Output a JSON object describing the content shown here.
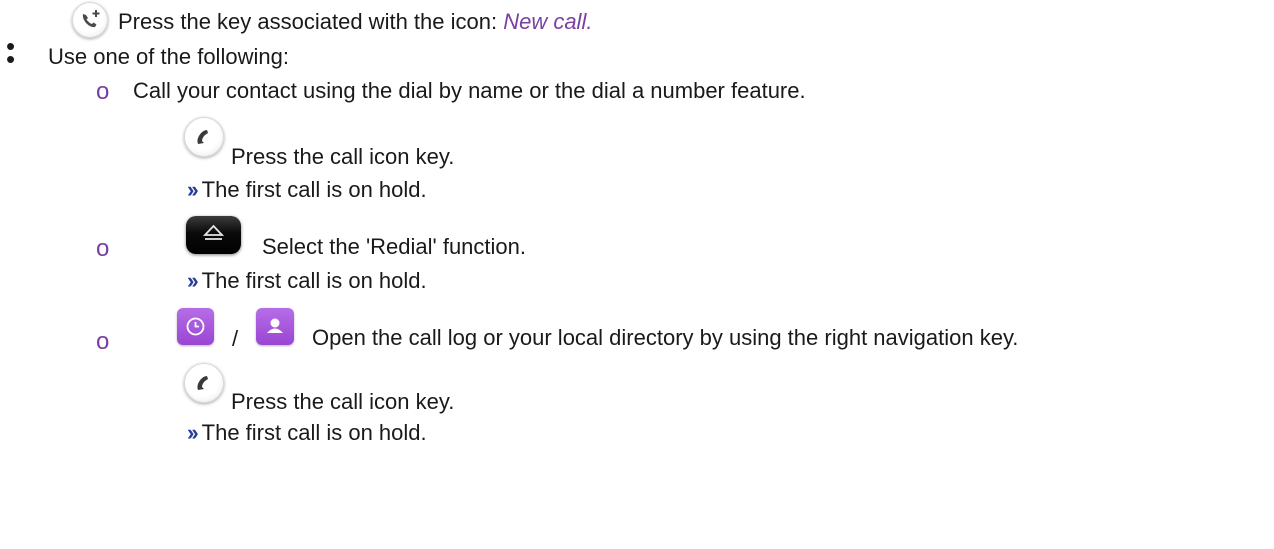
{
  "step1": {
    "bullet": "•",
    "icon": "new-call-icon",
    "text": "Press the key associated with the icon: ",
    "link": "New call."
  },
  "step2": {
    "bullet": "•",
    "text": "Use one of the following:"
  },
  "options": [
    {
      "bullet": "o",
      "text": "Call your contact using the dial by name or the dial a number feature.",
      "action_icon": "call-handset-icon",
      "action_text": "Press the call icon key.",
      "result_mark": "››",
      "result_text": "The first call is on hold."
    },
    {
      "bullet": "o",
      "icon": "redial-key-icon",
      "text": "Select the 'Redial' function.",
      "result_mark": "››",
      "result_text": "The first call is on hold."
    },
    {
      "bullet": "o",
      "icons": [
        "call-log-icon",
        "directory-icon"
      ],
      "separator": "/",
      "text": "Open the call log or your local directory by using the right navigation key.",
      "action_icon": "call-handset-icon",
      "action_text": "Press the call icon key.",
      "result_mark": "››",
      "result_text": "The first call is on hold."
    }
  ],
  "colors": {
    "accent_purple": "#7a3fa0",
    "result_mark_blue": "#2a3d9a",
    "tile_purple": "#a855dd"
  }
}
